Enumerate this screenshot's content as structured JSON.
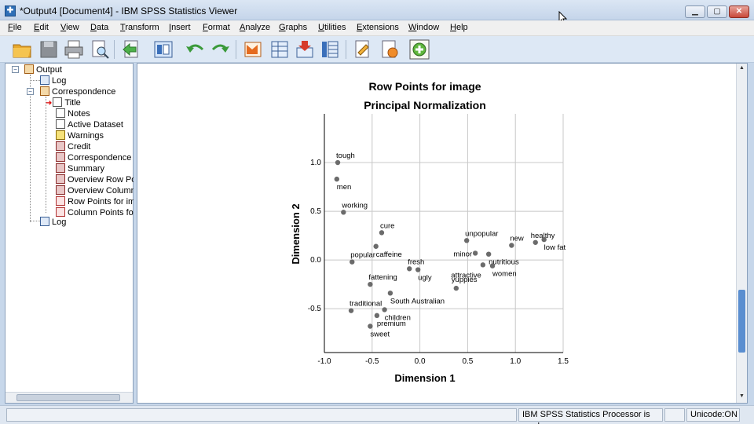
{
  "window": {
    "title": "*Output4 [Document4] - IBM SPSS Statistics Viewer",
    "app_icon": "spss-icon",
    "min_label": "▁",
    "max_label": "▢",
    "close_label": "✕"
  },
  "menu": {
    "items": [
      "File",
      "Edit",
      "View",
      "Data",
      "Transform",
      "Insert",
      "Format",
      "Analyze",
      "Graphs",
      "Utilities",
      "Extensions",
      "Window",
      "Help"
    ]
  },
  "toolbar": {
    "buttons": [
      "open-folder-icon",
      "save-icon",
      "print-icon",
      "print-preview-icon",
      "export-icon",
      "recall-dialog-icon",
      "undo-icon",
      "redo-icon",
      "goto-data-icon",
      "goto-case-icon",
      "goto-variable-icon",
      "variables-icon",
      "insert-output-icon",
      "script-icon",
      "add-icon"
    ]
  },
  "tree": {
    "items": [
      {
        "label": "Output",
        "icon": "output-book-icon"
      },
      {
        "label": "Log",
        "icon": "log-icon"
      },
      {
        "label": "Correspondence",
        "icon": "procedure-book-icon"
      },
      {
        "label": "Title",
        "icon": "title-icon"
      },
      {
        "label": "Notes",
        "icon": "notes-icon"
      },
      {
        "label": "Active Dataset",
        "icon": "dataset-icon"
      },
      {
        "label": "Warnings",
        "icon": "warning-icon"
      },
      {
        "label": "Credit",
        "icon": "table-icon"
      },
      {
        "label": "Correspondence T",
        "icon": "table-icon"
      },
      {
        "label": "Summary",
        "icon": "table-icon"
      },
      {
        "label": "Overview Row Poi",
        "icon": "table-icon"
      },
      {
        "label": "Overview Column",
        "icon": "table-icon"
      },
      {
        "label": "Row Points for im",
        "icon": "chart-icon"
      },
      {
        "label": "Column Points for",
        "icon": "chart-icon"
      },
      {
        "label": "Log",
        "icon": "log-icon"
      }
    ]
  },
  "chart_data": {
    "type": "scatter",
    "title": "Row Points for image",
    "subtitle": "Principal Normalization",
    "xlabel": "Dimension 1",
    "ylabel": "Dimension 2",
    "xlim": [
      -1.0,
      1.5
    ],
    "ylim": [
      -0.95,
      1.5
    ],
    "xticks": [
      "-1.0",
      "-0.5",
      "0.0",
      "0.5",
      "1.0",
      "1.5"
    ],
    "yticks": [
      "1.0",
      "0.5",
      "0.0",
      "-0.5"
    ],
    "xtick_values": [
      -1.0,
      -0.5,
      0.0,
      0.5,
      1.0,
      1.5
    ],
    "ytick_values": [
      1.0,
      0.5,
      0.0,
      -0.5
    ],
    "grid": true,
    "point_color": "#6b6b6b",
    "points": [
      {
        "label": "tough",
        "x": -0.86,
        "y": 1.0
      },
      {
        "label": "men",
        "x": -0.87,
        "y": 0.83
      },
      {
        "label": "working",
        "x": -0.8,
        "y": 0.49
      },
      {
        "label": "cure",
        "x": -0.4,
        "y": 0.28
      },
      {
        "label": "caffeine",
        "x": -0.46,
        "y": 0.14
      },
      {
        "label": "popular",
        "x": -0.71,
        "y": -0.02
      },
      {
        "label": "fresh",
        "x": -0.11,
        "y": -0.09
      },
      {
        "label": "ugly",
        "x": -0.02,
        "y": -0.1
      },
      {
        "label": "fattening",
        "x": -0.52,
        "y": -0.25
      },
      {
        "label": "South Australian",
        "x": -0.31,
        "y": -0.34
      },
      {
        "label": "children",
        "x": -0.37,
        "y": -0.51
      },
      {
        "label": "traditional",
        "x": -0.72,
        "y": -0.52
      },
      {
        "label": "premium",
        "x": -0.45,
        "y": -0.57
      },
      {
        "label": "sweet",
        "x": -0.52,
        "y": -0.68
      },
      {
        "label": "unpopular",
        "x": 0.49,
        "y": 0.2
      },
      {
        "label": "minor",
        "x": 0.58,
        "y": 0.07
      },
      {
        "label": "nutritious",
        "x": 0.72,
        "y": 0.06
      },
      {
        "label": "attractive",
        "x": 0.66,
        "y": -0.05
      },
      {
        "label": "women",
        "x": 0.76,
        "y": -0.06
      },
      {
        "label": "yuppies",
        "x": 0.38,
        "y": -0.29
      },
      {
        "label": "new",
        "x": 0.96,
        "y": 0.15
      },
      {
        "label": "healthy",
        "x": 1.21,
        "y": 0.18
      },
      {
        "label": "low fat",
        "x": 1.3,
        "y": 0.21
      }
    ]
  },
  "status": {
    "processor": "IBM SPSS Statistics Processor is ready",
    "unicode": "Unicode:ON"
  }
}
